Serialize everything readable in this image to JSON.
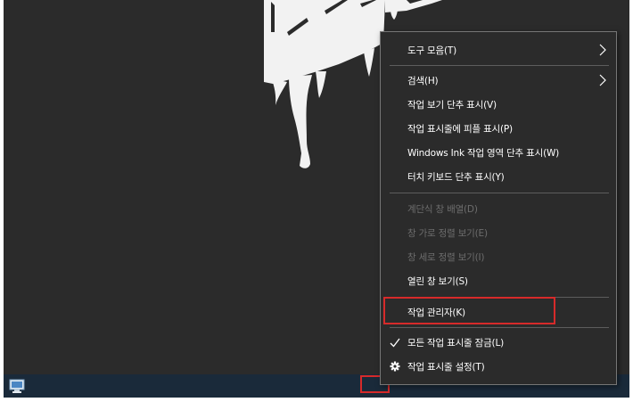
{
  "menu": {
    "items": [
      {
        "label": "도구 모음(T)",
        "enabled": true,
        "submenu": true
      },
      {
        "label": "검색(H)",
        "enabled": true,
        "submenu": true
      },
      {
        "label": "작업 보기 단추 표시(V)",
        "enabled": true
      },
      {
        "label": "작업 표시줄에 피플 표시(P)",
        "enabled": true
      },
      {
        "label": "Windows Ink 작업 영역 단추 표시(W)",
        "enabled": true
      },
      {
        "label": "터치 키보드 단추 표시(Y)",
        "enabled": true
      },
      {
        "label": "계단식 창 배열(D)",
        "enabled": false
      },
      {
        "label": "창 가로 정렬 보기(E)",
        "enabled": false
      },
      {
        "label": "창 세로 정렬 보기(I)",
        "enabled": false
      },
      {
        "label": "열린 창 보기(S)",
        "enabled": true
      },
      {
        "label": "작업 관리자(K)",
        "enabled": true,
        "highlighted": true
      },
      {
        "label": "모든 작업 표시줄 잠금(L)",
        "enabled": true,
        "checked": true,
        "icon": "check-icon"
      },
      {
        "label": "작업 표시줄 설정(T)",
        "enabled": true,
        "icon": "gear-icon"
      }
    ]
  },
  "colors": {
    "menu_background": "#2b2b2b",
    "text": "#ffffff",
    "disabled_text": "#6d6d6d",
    "highlight": "#d72a2a",
    "taskbar": "#1a2a3a"
  },
  "icons": {
    "taskbar_app": "pc-monitor-icon",
    "submenu": "chevron-right-icon"
  }
}
